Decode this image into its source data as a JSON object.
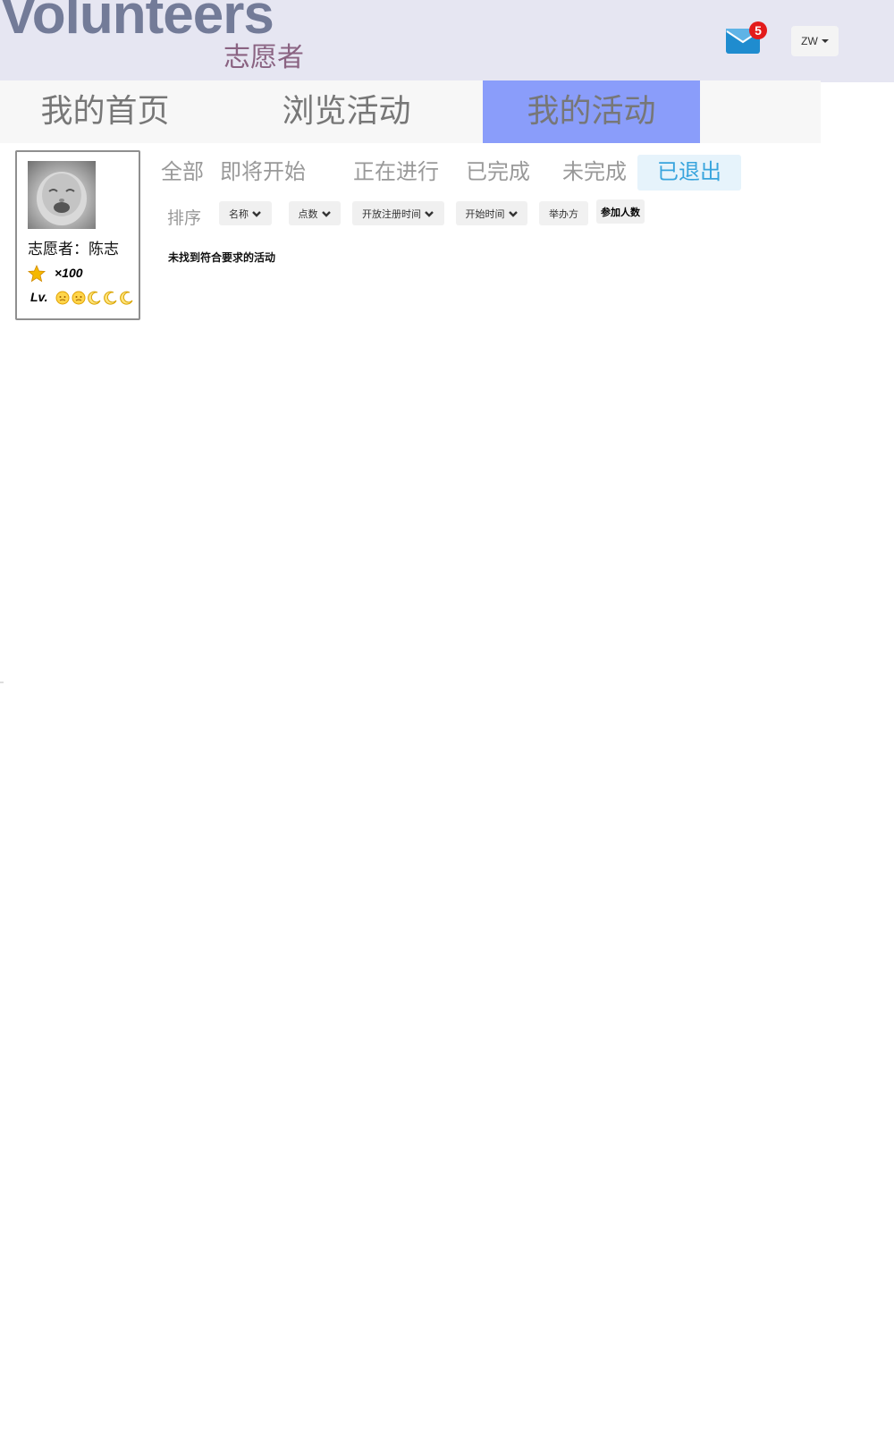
{
  "header": {
    "logo_en": "Volunteers",
    "logo_cn": "志愿者",
    "mail_badge": "5",
    "user_label": "ZW"
  },
  "nav": {
    "items": [
      {
        "label": "我的首页"
      },
      {
        "label": "浏览活动"
      },
      {
        "label": "我的活动"
      }
    ],
    "active_index": 2
  },
  "profile": {
    "name": "志愿者：陈志",
    "points": "×100",
    "level_label": "Lv."
  },
  "filters": {
    "tabs": [
      "全部",
      "即将开始",
      "正在进行",
      "已完成",
      "未完成",
      "已退出"
    ],
    "active_index": 5
  },
  "sort": {
    "label": "排序",
    "buttons": [
      "名称",
      "点数",
      "开放注册时间",
      "开始时间",
      "举办方",
      "参加人数"
    ]
  },
  "results": {
    "empty_message": "未找到符合要求的活动"
  },
  "colors": {
    "header_bg": "#e6e6f2",
    "logo_en": "#737b98",
    "logo_cn": "#8a6382",
    "nav_active": "#8a9dfa",
    "filter_active_bg": "#e6f3fb",
    "filter_active_text": "#38a4dd",
    "badge": "#e31b1b"
  }
}
